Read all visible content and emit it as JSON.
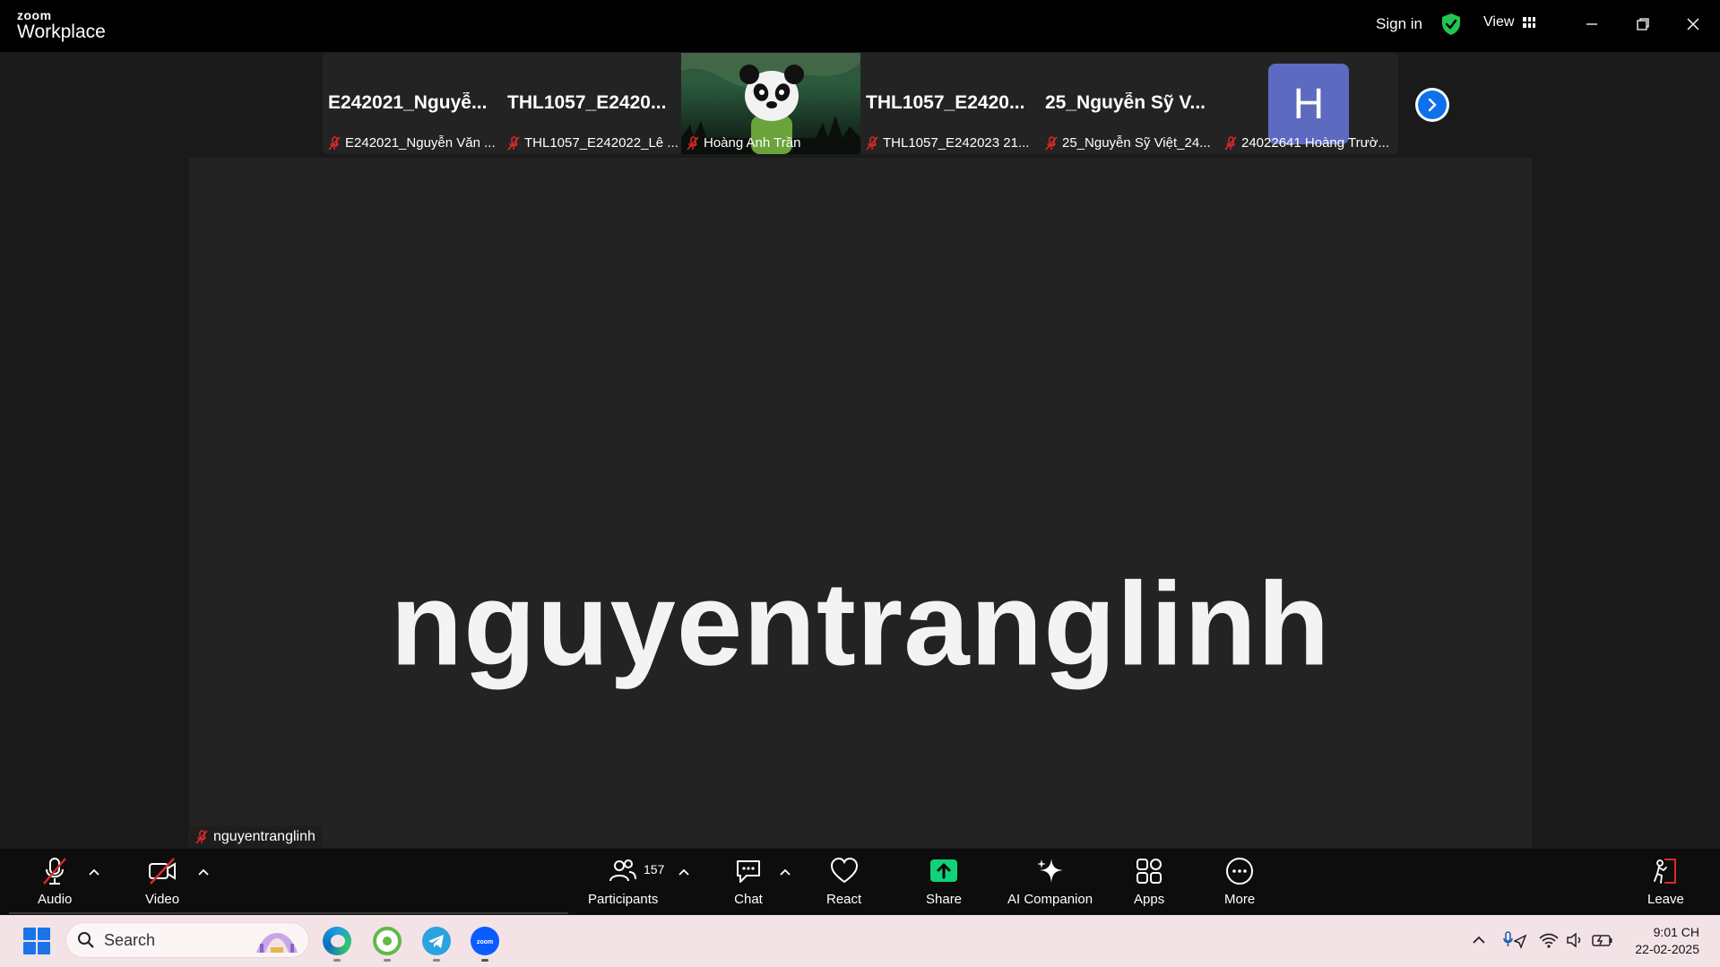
{
  "titlebar": {
    "logo_top": "zoom",
    "logo_bottom": "Workplace",
    "sign_in": "Sign in",
    "view": "View"
  },
  "thumbnails": [
    {
      "big_name": "E242021_Nguyễ...",
      "label": "E242021_Nguyễn Văn ..."
    },
    {
      "big_name": "THL1057_E2420...",
      "label": "THL1057_E242022_Lê ..."
    },
    {
      "big_name": "",
      "label": "Hoàng Anh Trần",
      "video": "panda"
    },
    {
      "big_name": "THL1057_E2420...",
      "label": "THL1057_E242023 21..."
    },
    {
      "big_name": "25_Nguyễn Sỹ V...",
      "label": "25_Nguyễn Sỹ Việt_24..."
    },
    {
      "big_name": "",
      "label": "24022641 Hoàng Trườ...",
      "avatar_letter": "H"
    }
  ],
  "speaker": {
    "display_name": "nguyentranglinh",
    "label": "nguyentranglinh"
  },
  "toolbar": {
    "audio": "Audio",
    "video": "Video",
    "participants": "Participants",
    "participants_count": "157",
    "chat": "Chat",
    "react": "React",
    "share": "Share",
    "ai_companion": "AI Companion",
    "apps": "Apps",
    "more": "More",
    "leave": "Leave"
  },
  "taskbar": {
    "search_placeholder": "Search",
    "time": "9:01 CH",
    "date": "22-02-2025"
  },
  "colors": {
    "accent_blue": "#0e71eb",
    "share_green": "#12d278",
    "shield_green": "#23c552",
    "mute_red": "#e02828",
    "avatar_purple": "#5c6bc0"
  }
}
